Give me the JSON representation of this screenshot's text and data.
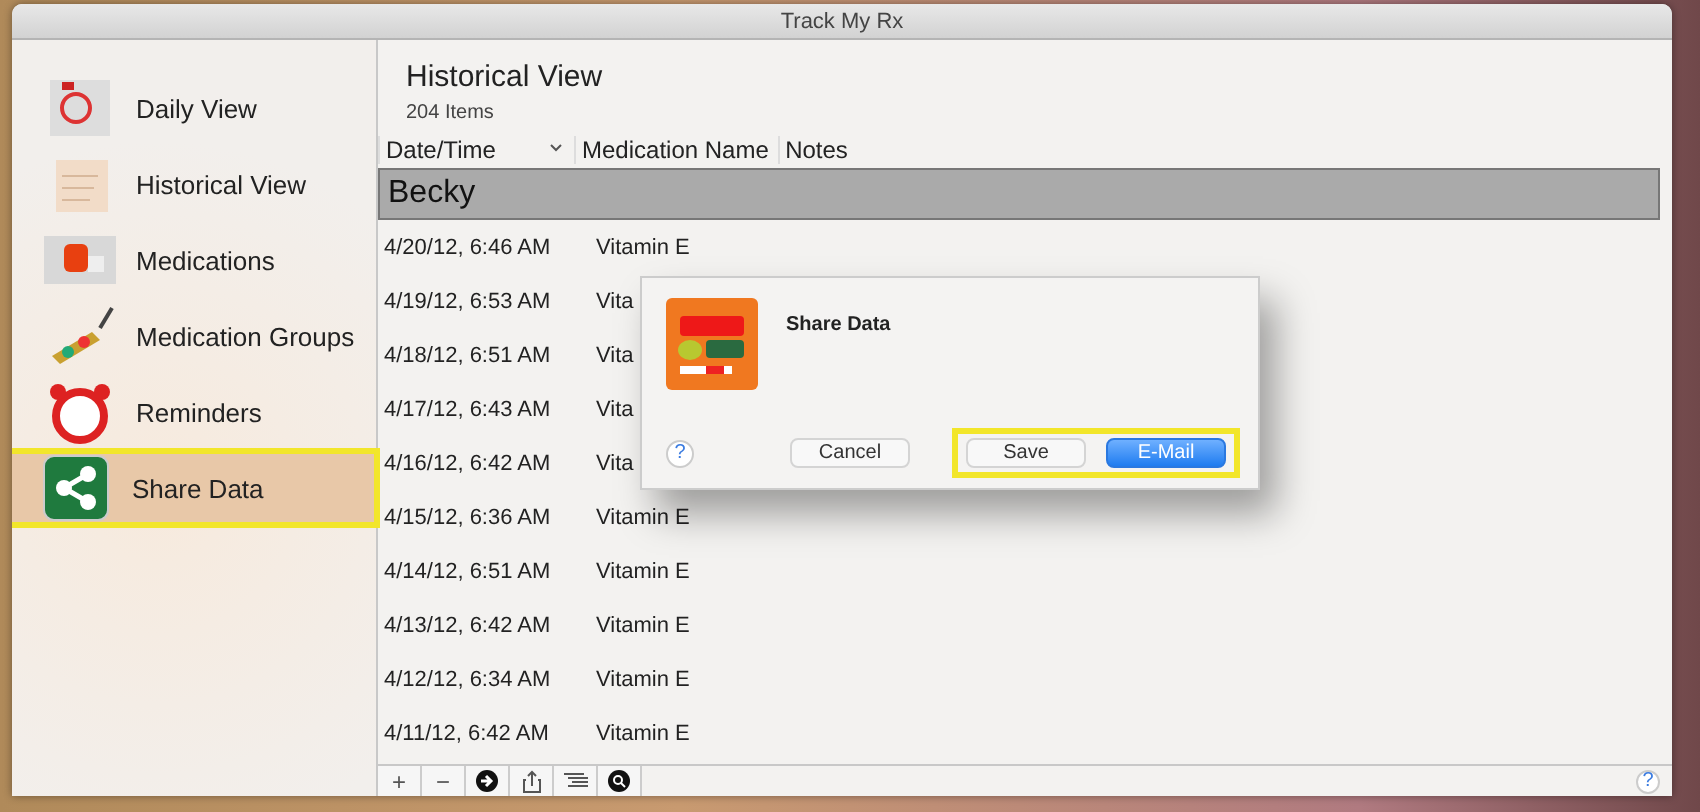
{
  "window": {
    "title": "Track My Rx"
  },
  "sidebar": {
    "items": [
      {
        "kind": "daily",
        "label": "Daily View",
        "selected": false,
        "highlighted": false
      },
      {
        "kind": "history",
        "label": "Historical View",
        "selected": false,
        "highlighted": false
      },
      {
        "kind": "meds",
        "label": "Medications",
        "selected": false,
        "highlighted": false
      },
      {
        "kind": "groups",
        "label": "Medication Groups",
        "selected": false,
        "highlighted": false
      },
      {
        "kind": "alarm",
        "label": "Reminders",
        "selected": false,
        "highlighted": false
      },
      {
        "kind": "share",
        "label": "Share Data",
        "selected": true,
        "highlighted": true
      }
    ]
  },
  "main": {
    "title": "Historical View",
    "count": "204 Items"
  },
  "table": {
    "columns": [
      {
        "label": "Date/Time",
        "sorted": true
      },
      {
        "label": "Medication Name",
        "sorted": false
      },
      {
        "label": "Notes",
        "sorted": false
      }
    ],
    "group": "Becky",
    "rows": [
      {
        "date": "4/20/12, 6:46 AM",
        "medication": "Vitamin E"
      },
      {
        "date": "4/19/12, 6:53 AM",
        "medication": "Vita"
      },
      {
        "date": "4/18/12, 6:51 AM",
        "medication": "Vita"
      },
      {
        "date": "4/17/12, 6:43 AM",
        "medication": "Vita"
      },
      {
        "date": "4/16/12, 6:42 AM",
        "medication": "Vita"
      },
      {
        "date": "4/15/12, 6:36 AM",
        "medication": "Vitamin E"
      },
      {
        "date": "4/14/12, 6:51 AM",
        "medication": "Vitamin E"
      },
      {
        "date": "4/13/12, 6:42 AM",
        "medication": "Vitamin E"
      },
      {
        "date": "4/12/12, 6:34 AM",
        "medication": "Vitamin E"
      },
      {
        "date": "4/11/12, 6:42 AM",
        "medication": "Vitamin E"
      }
    ]
  },
  "toolbar": {
    "items": [
      {
        "kind": "text",
        "label": "+"
      },
      {
        "kind": "text",
        "label": "−"
      },
      {
        "kind": "arrow"
      },
      {
        "kind": "share"
      },
      {
        "kind": "list"
      },
      {
        "kind": "search"
      }
    ],
    "help": "?"
  },
  "dialog": {
    "title": "Share Data",
    "help": "?",
    "buttons": [
      {
        "label": "Cancel",
        "default": false
      },
      {
        "label": "Save",
        "default": false
      },
      {
        "label": "E-Mail",
        "default": true
      }
    ],
    "buttons_highlighted": true
  }
}
